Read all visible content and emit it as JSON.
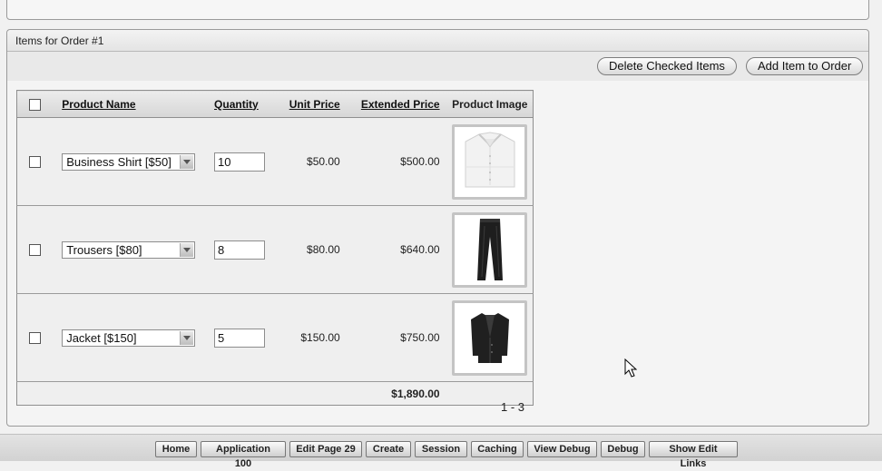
{
  "region": {
    "title": "Items for Order #1"
  },
  "buttons": {
    "delete_checked": "Delete Checked Items",
    "add_item": "Add Item to Order"
  },
  "table": {
    "headers": {
      "product_name": "Product Name",
      "quantity": "Quantity",
      "unit_price": "Unit Price",
      "extended_price": "Extended Price",
      "product_image": "Product Image"
    },
    "rows": [
      {
        "product": "Business Shirt [$50]",
        "quantity": "10",
        "unit_price": "$50.00",
        "extended_price": "$500.00",
        "image": "shirt-icon"
      },
      {
        "product": "Trousers [$80]",
        "quantity": "8",
        "unit_price": "$80.00",
        "extended_price": "$640.00",
        "image": "trousers-icon"
      },
      {
        "product": "Jacket [$150]",
        "quantity": "5",
        "unit_price": "$150.00",
        "extended_price": "$750.00",
        "image": "jacket-icon"
      }
    ],
    "total": "$1,890.00"
  },
  "pagination": "1 - 3",
  "dev_toolbar": {
    "home": "Home",
    "application": "Application 100",
    "edit_page": "Edit Page 29",
    "create": "Create",
    "session": "Session",
    "caching": "Caching",
    "view_debug": "View Debug",
    "debug": "Debug",
    "show_edit_links": "Show Edit Links"
  },
  "colors": {
    "background": "#f1f1f1",
    "header_gradient_top": "#ececec",
    "header_gradient_bottom": "#d6d6d6",
    "border": "#8f8f8f"
  }
}
